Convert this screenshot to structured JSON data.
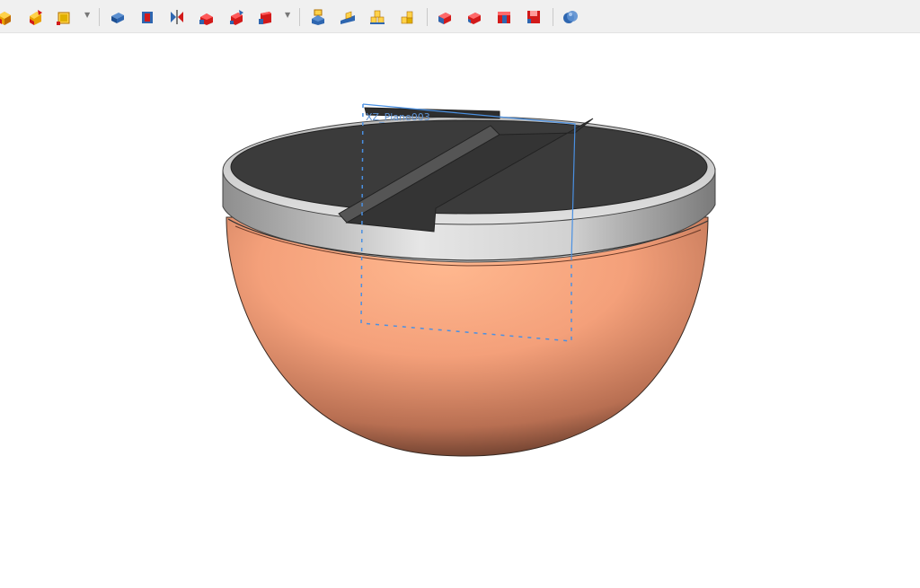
{
  "toolbar": {
    "groups": [
      {
        "items": [
          "part-box-icon",
          "part-chamfer-icon",
          "part-cube-icon"
        ],
        "has_dropdown": true
      },
      {
        "items": [
          "part-extrude-icon",
          "part-revolve-icon",
          "part-mirror-icon",
          "part-fillet-icon",
          "part-chamfer2-icon",
          "part-section-icon"
        ],
        "has_dropdown": true
      },
      {
        "items": [
          "part-compound-icon",
          "part-loft-icon",
          "part-sweep-icon",
          "part-thickness-icon"
        ],
        "has_dropdown": false
      },
      {
        "items": [
          "part-boolean-icon",
          "part-cut-icon",
          "part-fuse-icon",
          "part-common-icon"
        ],
        "has_dropdown": false
      },
      {
        "items": [
          "part-sphere-icon"
        ],
        "has_dropdown": false
      }
    ]
  },
  "viewport": {
    "plane_label": "XZ_Plane003",
    "colors": {
      "background": "#ffffff",
      "lid": "#3a3a3a",
      "rim": "#cfcfcf",
      "bowl": "#f6a57f",
      "plane_outline": "#4a90e2"
    }
  }
}
